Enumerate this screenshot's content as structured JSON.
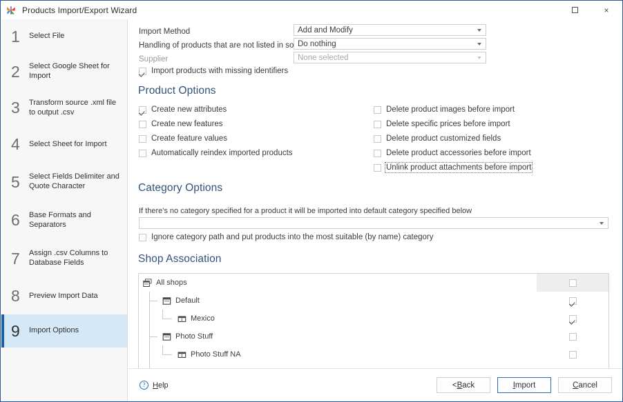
{
  "window": {
    "title": "Products Import/Export Wizard",
    "app_icon": "butterfly-logo-icon",
    "controls": {
      "maximize": "maximize-icon",
      "close": "×"
    }
  },
  "sidebar": {
    "items": [
      {
        "num": "1",
        "label": "Select File",
        "active": false
      },
      {
        "num": "2",
        "label": "Select Google Sheet for Import",
        "active": false
      },
      {
        "num": "3",
        "label": "Transform source .xml file to output .csv",
        "active": false
      },
      {
        "num": "4",
        "label": "Select Sheet for Import",
        "active": false
      },
      {
        "num": "5",
        "label": "Select Fields Delimiter and Quote Character",
        "active": false
      },
      {
        "num": "6",
        "label": "Base Formats and Separators",
        "active": false
      },
      {
        "num": "7",
        "label": "Assign .csv Columns to Database Fields",
        "active": false
      },
      {
        "num": "8",
        "label": "Preview Import Data",
        "active": false
      },
      {
        "num": "9",
        "label": "Import Options",
        "active": true
      }
    ]
  },
  "form": {
    "import_method_label": "Import Method",
    "import_method_value": "Add and Modify",
    "handling_label": "Handling of products that are not listed in source file",
    "handling_value": "Do nothing",
    "supplier_label": "Supplier",
    "supplier_value": "None selected",
    "missing_identifiers_label": "Import products with missing identifiers",
    "missing_identifiers_checked": true
  },
  "product_options": {
    "heading": "Product Options",
    "left": [
      {
        "label": "Create new attributes",
        "checked": true
      },
      {
        "label": "Create new features",
        "checked": false
      },
      {
        "label": "Create feature values",
        "checked": false
      },
      {
        "label": "Automatically reindex imported products",
        "checked": false
      }
    ],
    "right": [
      {
        "label": "Delete product images before import",
        "checked": false
      },
      {
        "label": "Delete specific prices before import",
        "checked": false
      },
      {
        "label": "Delete product customized fields",
        "checked": false
      },
      {
        "label": "Delete product accessories before import",
        "checked": false
      },
      {
        "label": "Unlink product attachments before import",
        "checked": false,
        "focused": true
      }
    ]
  },
  "category_options": {
    "heading": "Category Options",
    "description": "If there's no category specified for a product it will be imported into default category specified below",
    "default_category_value": "",
    "ignore_path_label": "Ignore category path and put products into the most suitable (by name) category",
    "ignore_path_checked": false
  },
  "shop_association": {
    "heading": "Shop Association",
    "nodes": [
      {
        "label": "All shops",
        "depth": 0,
        "icon": "all-shops-icon",
        "checked": false,
        "highlight": true
      },
      {
        "label": "Default",
        "depth": 1,
        "icon": "shop-group-icon",
        "checked": true,
        "highlight": false
      },
      {
        "label": "Mexico",
        "depth": 2,
        "icon": "shop-icon",
        "checked": true,
        "highlight": false
      },
      {
        "label": "Photo Stuff",
        "depth": 1,
        "icon": "shop-group-icon",
        "checked": false,
        "highlight": false
      },
      {
        "label": "Photo Stuff NA",
        "depth": 2,
        "icon": "shop-icon",
        "checked": false,
        "highlight": false
      }
    ]
  },
  "footer": {
    "help_label": "Help",
    "help_icon": "question-circle-icon",
    "back_label": "< Back",
    "import_label": "Import",
    "cancel_label": "Cancel"
  },
  "colors": {
    "accent": "#2b579a",
    "sidebar_active_bg": "#d5e8f8",
    "sidebar_active_bar": "#1f5fa9",
    "section_heading": "#30527a",
    "link_blue": "#2b6cb8"
  }
}
